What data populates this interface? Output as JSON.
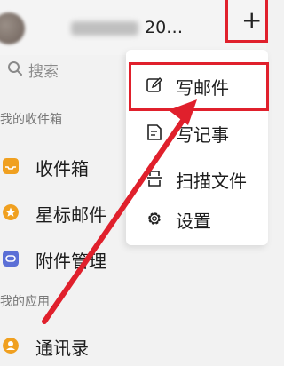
{
  "header": {
    "title": "20…",
    "plus_symbol": "+"
  },
  "search": {
    "placeholder": "搜索",
    "icon": "search-icon"
  },
  "sections": {
    "inbox_label": "我的收件箱",
    "apps_label": "我的应用"
  },
  "nav": [
    {
      "label": "收件箱",
      "icon": "inbox-icon",
      "color": "#f0a020"
    },
    {
      "label": "星标邮件",
      "icon": "star-icon",
      "color": "#f0a020"
    },
    {
      "label": "附件管理",
      "icon": "attachment-icon",
      "color": "#5b6fd6"
    }
  ],
  "apps": [
    {
      "label": "通讯录",
      "icon": "contacts-icon",
      "color": "#f0a020"
    }
  ],
  "menu": {
    "items": [
      {
        "label": "写邮件",
        "icon": "compose-icon"
      },
      {
        "label": "写记事",
        "icon": "note-icon"
      },
      {
        "label": "扫描文件",
        "icon": "scan-icon"
      },
      {
        "label": "设置",
        "icon": "gear-icon"
      }
    ]
  },
  "annotation_color": "#e0202c"
}
